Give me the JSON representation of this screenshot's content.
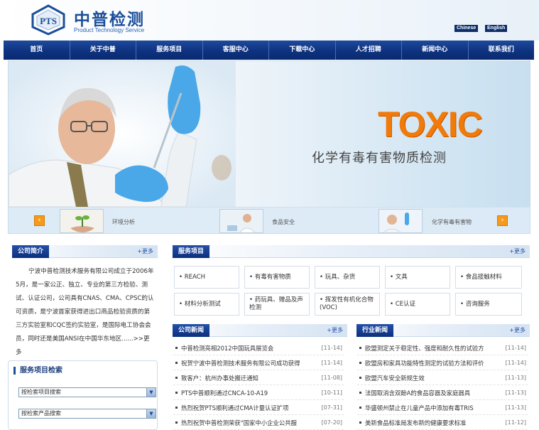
{
  "header": {
    "logo_letters": "PTS",
    "logo_cn": "中普检测",
    "logo_en": "Product Technology Service",
    "lang_cn": "Chinese",
    "lang_en": "English"
  },
  "nav": [
    "首页",
    "关于中普",
    "服务项目",
    "客服中心",
    "下载中心",
    "人才招聘",
    "新闻中心",
    "联系我们"
  ],
  "banner": {
    "headline": "TOXIC",
    "subtitle": "化学有毒有害物质检测",
    "thumbs": [
      {
        "label": "环境分析"
      },
      {
        "label": "食品安全"
      },
      {
        "label": "化学有毒有害物"
      }
    ],
    "prev": "‹",
    "next": "›"
  },
  "intro": {
    "title": "公司简介",
    "more": "+更多",
    "text": "宁波中普检测技术服务有限公司成立于2006年5月，是一家公正、独立、专业的第三方检验、测试、认证公司，公司具有CNAS、CMA、CPSC的认可资质，是宁波首家获得进出口商品检验资质的第三方实验室和CQC签约实验室，是国际电工协会会员，同时还是美国ANSI在中国华东地区......>>更多"
  },
  "search": {
    "title": "服务项目检索",
    "select1": "按检索项目搜索",
    "select2": "按检索产品搜索"
  },
  "services": {
    "title": "服务项目",
    "more": "+更多",
    "items": [
      "• REACH",
      "• 有毒有害物质",
      "• 玩具、杂货",
      "• 文具",
      "• 食品接触材料",
      "• 材料分析测试",
      "• 药玩具、赠品及声检测",
      "• 挥发性有机化合物(VOC)",
      "• CE认证",
      "• 咨询服务"
    ]
  },
  "company_news": {
    "title": "公司新闻",
    "more": "+更多",
    "items": [
      {
        "title": "中普检测亮相2012中国玩具展览会",
        "date": "[11-14]"
      },
      {
        "title": "祝贺宁波中普检测技术服务有限公司成功获得",
        "date": "[11-14]"
      },
      {
        "title": "致客户：杭州办事处搬迁通知",
        "date": "[11-08]"
      },
      {
        "title": "PTS中普顺利通过CNCA-10-A19",
        "date": "[10-11]"
      },
      {
        "title": "热烈祝贺PTS顺利通过CMA计量认证扩项",
        "date": "[07-31]"
      },
      {
        "title": "热烈祝贺中普检测荣获\"国家中小企业公共服",
        "date": "[07-20]"
      }
    ]
  },
  "industry_news": {
    "title": "行业新闻",
    "more": "+更多",
    "items": [
      {
        "title": "欧盟测定关于稳定性、强度和耐久性的试验方",
        "date": "[11-14]"
      },
      {
        "title": "欧盟房和家具功能特性测定的试验方法和评价",
        "date": "[11-14]"
      },
      {
        "title": "欧盟汽车安全新规生效",
        "date": "[11-13]"
      },
      {
        "title": "法国取消含双酚A的食品容器及家庭器具",
        "date": "[11-13]"
      },
      {
        "title": "华盛顿州禁止在儿童产品中添加有毒TRIS",
        "date": "[11-13]"
      },
      {
        "title": "美新食品标准局发布新的健康要求标准",
        "date": "[11-12]"
      }
    ]
  },
  "colors": {
    "nav_bg": "#0e3280",
    "brand_blue": "#1b4f9a",
    "accent_orange": "#f07a0a"
  }
}
